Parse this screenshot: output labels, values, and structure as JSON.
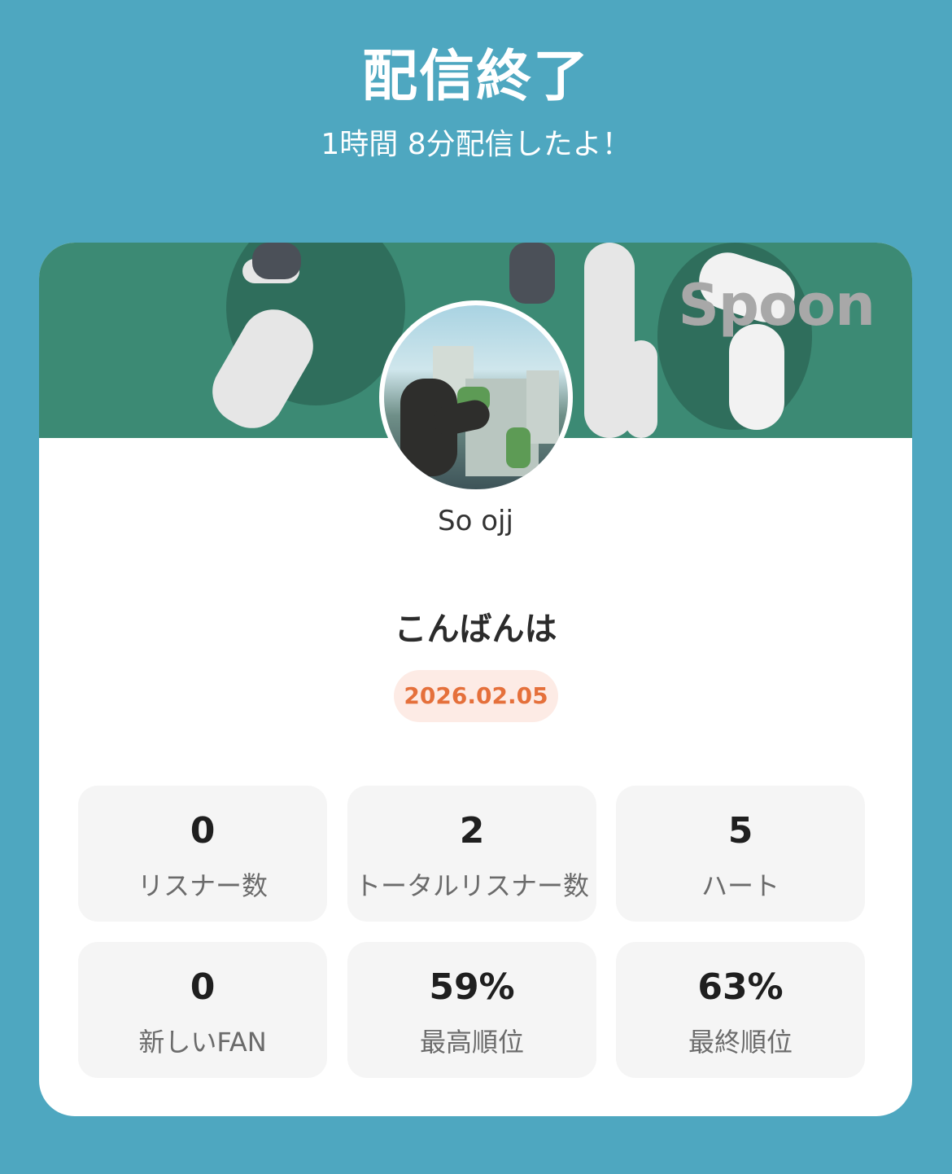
{
  "header": {
    "title": "配信終了",
    "subtitle": "1時間 8分配信したよ！"
  },
  "card": {
    "brand": "Spoon",
    "username": "So ojj",
    "stream_title": "こんばんは",
    "date": "2026.02.05",
    "colors": {
      "background": "#4ea7c0",
      "banner": "#3c8a74",
      "date_text": "#e5703b",
      "date_bg": "#fdebe5"
    },
    "stats": [
      {
        "value": "0",
        "label": "リスナー数"
      },
      {
        "value": "2",
        "label": "トータルリスナー数"
      },
      {
        "value": "5",
        "label": "ハート"
      },
      {
        "value": "0",
        "label": "新しいFAN"
      },
      {
        "value": "59%",
        "label": "最高順位"
      },
      {
        "value": "63%",
        "label": "最終順位"
      }
    ]
  }
}
